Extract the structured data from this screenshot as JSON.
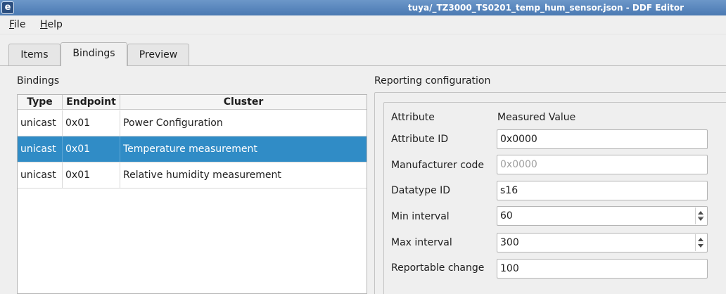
{
  "window": {
    "title": "tuya/_TZ3000_TS0201_temp_hum_sensor.json - DDF Editor",
    "app_icon": "e"
  },
  "menu": {
    "file": "File",
    "file_mnemonic": "F",
    "file_rest": "ile",
    "help": "Help",
    "help_mnemonic": "H",
    "help_rest": "elp"
  },
  "tabs": [
    {
      "label": "Items",
      "active": false
    },
    {
      "label": "Bindings",
      "active": true
    },
    {
      "label": "Preview",
      "active": false
    }
  ],
  "bindings": {
    "section_label": "Bindings",
    "columns": [
      "Type",
      "Endpoint",
      "Cluster"
    ],
    "rows": [
      {
        "type": "unicast",
        "endpoint": "0x01",
        "cluster": "Power Configuration",
        "selected": false
      },
      {
        "type": "unicast",
        "endpoint": "0x01",
        "cluster": "Temperature measurement",
        "selected": true
      },
      {
        "type": "unicast",
        "endpoint": "0x01",
        "cluster": "Relative humidity measurement",
        "selected": false
      }
    ]
  },
  "reporting": {
    "section_label": "Reporting configuration",
    "attribute_label": "Attribute",
    "attribute_value": "Measured Value",
    "attribute_id_label": "Attribute ID",
    "attribute_id_value": "0x0000",
    "manufacturer_code_label": "Manufacturer code",
    "manufacturer_code_placeholder": "0x0000",
    "datatype_id_label": "Datatype ID",
    "datatype_id_value": "s16",
    "min_interval_label": "Min interval",
    "min_interval_value": "60",
    "max_interval_label": "Max interval",
    "max_interval_value": "300",
    "reportable_change_label": "Reportable change",
    "reportable_change_value": "100"
  },
  "colors": {
    "titlebar": "#4a79b2",
    "selection": "#308cc6",
    "window_bg": "#efefef"
  }
}
